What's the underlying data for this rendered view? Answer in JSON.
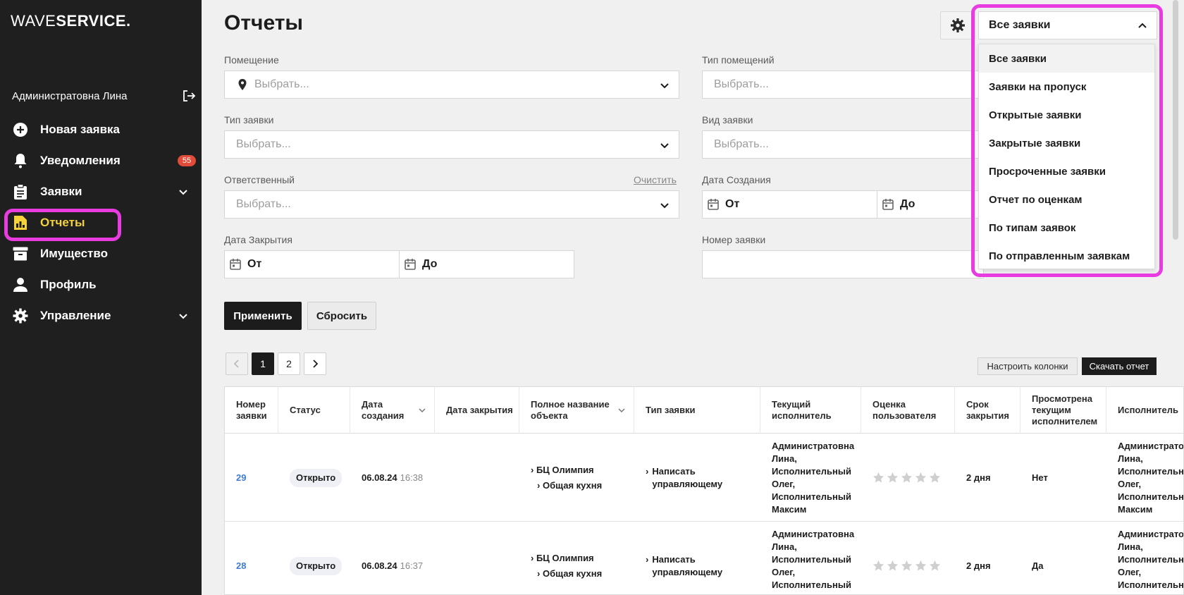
{
  "app": {
    "logo_thin": "WAVE",
    "logo_bold": "SERVICE."
  },
  "sidebar": {
    "user_name": "Администратовна Лина",
    "items": [
      {
        "label": "Новая заявка",
        "icon": "plus-circle-icon"
      },
      {
        "label": "Уведомления",
        "icon": "bell-icon",
        "badge": "55"
      },
      {
        "label": "Заявки",
        "icon": "clipboard-icon",
        "expandable": true
      },
      {
        "label": "Отчеты",
        "icon": "report-icon",
        "active": true
      },
      {
        "label": "Имущество",
        "icon": "archive-icon"
      },
      {
        "label": "Профиль",
        "icon": "person-icon"
      },
      {
        "label": "Управление",
        "icon": "gear-icon",
        "expandable": true
      }
    ]
  },
  "page": {
    "title": "Отчеты"
  },
  "filters": {
    "room_label": "Помещение",
    "room_placeholder": "Выбрать...",
    "room_type_label": "Тип помещений",
    "room_type_placeholder": "Выбрать...",
    "request_type_label": "Тип заявки",
    "request_type_placeholder": "Выбрать...",
    "request_kind_label": "Вид заявки",
    "request_kind_placeholder": "Выбрать...",
    "responsible_label": "Ответственный",
    "responsible_placeholder": "Выбрать...",
    "clear_label": "Очистить",
    "created_label": "Дата Создания",
    "closed_label": "Дата Закрытия",
    "from_label": "От",
    "to_label": "До",
    "number_label": "Номер заявки",
    "apply_label": "Применить",
    "reset_label": "Сбросить"
  },
  "pager": {
    "pages": [
      "1",
      "2"
    ],
    "current": "1"
  },
  "actions": {
    "columns_label": "Настроить колонки",
    "download_label": "Скачать отчет"
  },
  "table": {
    "headers": {
      "number": "Номер заявки",
      "status": "Статус",
      "created": "Дата создания",
      "closed": "Дата закрытия",
      "object": "Полное название объекта",
      "type": "Тип заявки",
      "executor": "Текущий исполнитель",
      "rating": "Оценка пользователя",
      "deadline": "Срок закрытия",
      "viewed": "Просмотрена текущим исполнителем",
      "performer": "Исполнитель"
    },
    "rows": [
      {
        "number": "29",
        "status": "Открыто",
        "date": "06.08.24",
        "time": "16:38",
        "object_l1": "БЦ Олимпия",
        "object_l2": "Общая кухня",
        "type": "Написать управляющему",
        "executor": "Администратовна Лина, Исполнительный Олег, Исполнительный Максим",
        "rating": 0,
        "deadline": "2 дня",
        "viewed": "Нет",
        "performer": "Администратовна Лина, Исполнительный Олег, Исполнительный Максим"
      },
      {
        "number": "28",
        "status": "Открыто",
        "date": "06.08.24",
        "time": "16:37",
        "object_l1": "БЦ Олимпия",
        "object_l2": "Общая кухня",
        "type": "Написать управляющему",
        "executor": "Администратовна Лина, Исполнительный Олег, Исполнительный Максим",
        "rating": 0,
        "deadline": "2 дня",
        "viewed": "Да",
        "performer": "Администратовна Лина, Исполнительный Олег, Исполнительный Максим"
      }
    ]
  },
  "report_select": {
    "selected": "Все заявки",
    "options": [
      "Все заявки",
      "Заявки на пропуск",
      "Открытые заявки",
      "Закрытые заявки",
      "Просроченные заявки",
      "Отчет по оценкам",
      "По типам заявок",
      "По отправленным заявкам"
    ]
  },
  "colors": {
    "sidebar_bg": "#1f1f1f",
    "active_nav": "#f5d33a",
    "highlight": "#e83ce0",
    "badge": "#e04b3a",
    "link": "#3d7bd6"
  }
}
